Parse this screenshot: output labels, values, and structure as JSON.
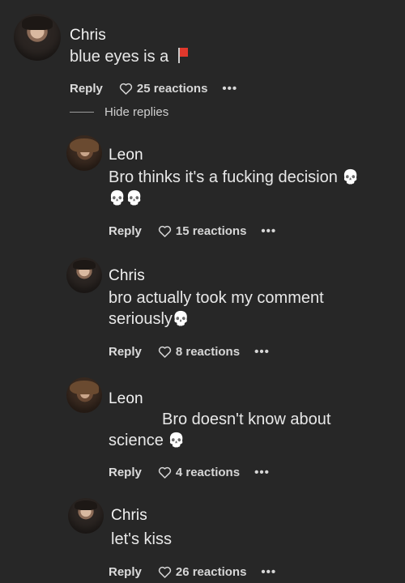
{
  "thread": {
    "hide_replies": "Hide replies"
  },
  "comments": [
    {
      "author": "Chris",
      "text": "blue eyes is a",
      "reply_label": "Reply",
      "reactions": "25 reactions",
      "more": "•••"
    },
    {
      "author": "Leon",
      "text_line1": "Bro thinks it's a fucking decision",
      "reply_label": "Reply",
      "reactions": "15 reactions",
      "more": "•••"
    },
    {
      "author": "Chris",
      "text_line1": "bro actually took my comment",
      "text_line2": "seriously",
      "reply_label": "Reply",
      "reactions": "8 reactions",
      "more": "•••"
    },
    {
      "author": "Leon",
      "text_line1": "Bro doesn't know about",
      "text_line2": "science",
      "reply_label": "Reply",
      "reactions": "4 reactions",
      "more": "•••"
    },
    {
      "author": "Chris",
      "text_line1": "let's kiss",
      "reply_label": "Reply",
      "reactions": "26 reactions",
      "more": "•••"
    }
  ],
  "icons": {
    "reaction": "heart-outline-icon",
    "flag": "red-flag-icon",
    "skull": "skull-emoji"
  },
  "colors": {
    "background": "#272727",
    "text": "#ececec",
    "flag": "#e0382c"
  }
}
